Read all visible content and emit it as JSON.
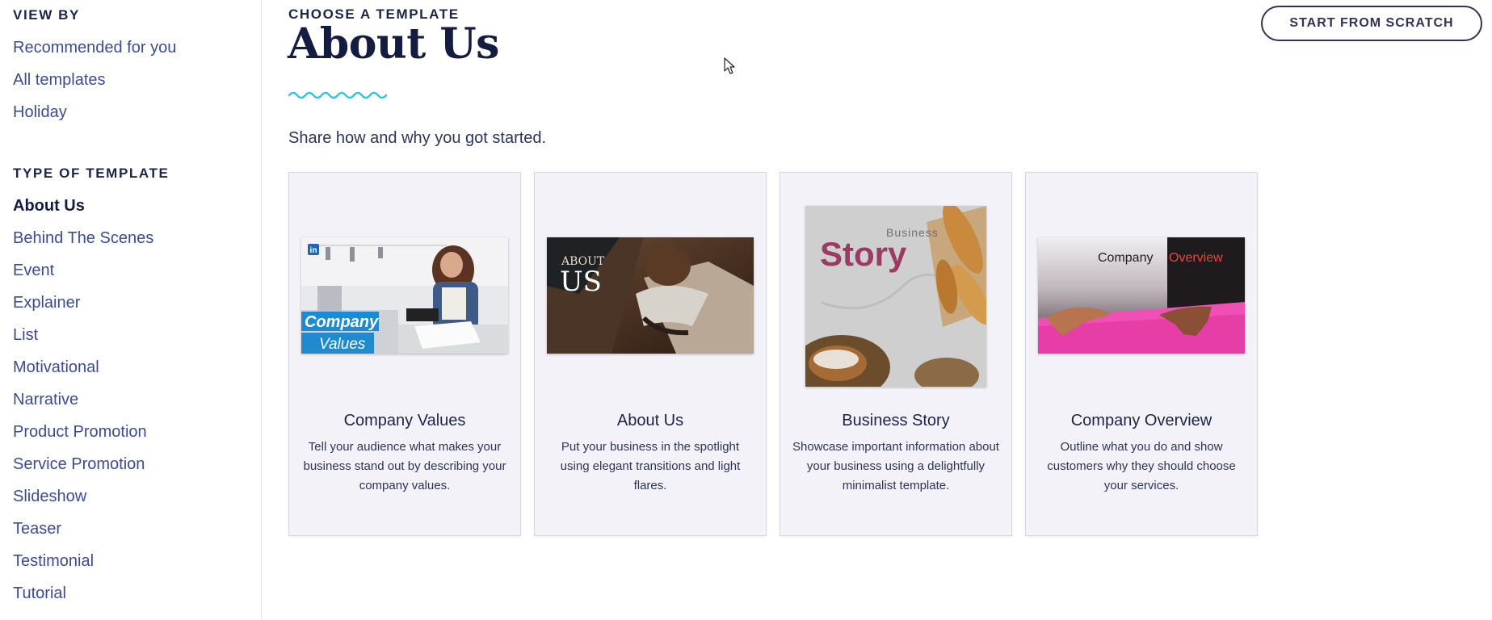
{
  "sidebar": {
    "view_by_title": "VIEW BY",
    "view_by_items": [
      {
        "label": "Recommended for you"
      },
      {
        "label": "All templates"
      },
      {
        "label": "Holiday"
      }
    ],
    "type_title": "TYPE OF TEMPLATE",
    "type_items": [
      {
        "label": "About Us",
        "active": true
      },
      {
        "label": "Behind The Scenes"
      },
      {
        "label": "Event"
      },
      {
        "label": "Explainer"
      },
      {
        "label": "List"
      },
      {
        "label": "Motivational"
      },
      {
        "label": "Narrative"
      },
      {
        "label": "Product Promotion"
      },
      {
        "label": "Service Promotion"
      },
      {
        "label": "Slideshow"
      },
      {
        "label": "Teaser"
      },
      {
        "label": "Testimonial"
      },
      {
        "label": "Tutorial"
      }
    ]
  },
  "main": {
    "eyebrow": "CHOOSE A TEMPLATE",
    "title": "About Us",
    "subtitle": "Share how and why you got started.",
    "scratch_button": "START FROM SCRATCH",
    "accent_color": "#35c3d6",
    "cards": [
      {
        "title": "Company Values",
        "description": "Tell your audience what makes your business stand out by describing your company values.",
        "thumb_text": {
          "line1": "Company",
          "line2": "Values",
          "badge": "in"
        }
      },
      {
        "title": "About Us",
        "description": "Put your business in the spotlight using elegant transitions and light flares.",
        "thumb_text": {
          "line1": "ABOUT",
          "line2": "US"
        }
      },
      {
        "title": "Business Story",
        "description": "Showcase important information about your business using a delightfully minimalist template.",
        "thumb_text": {
          "line1": "Business",
          "line2": "Story"
        }
      },
      {
        "title": "Company Overview",
        "description": "Outline what you do and show customers why they should choose your services.",
        "thumb_text": {
          "line1": "Company",
          "line2": "Overview"
        }
      }
    ]
  }
}
